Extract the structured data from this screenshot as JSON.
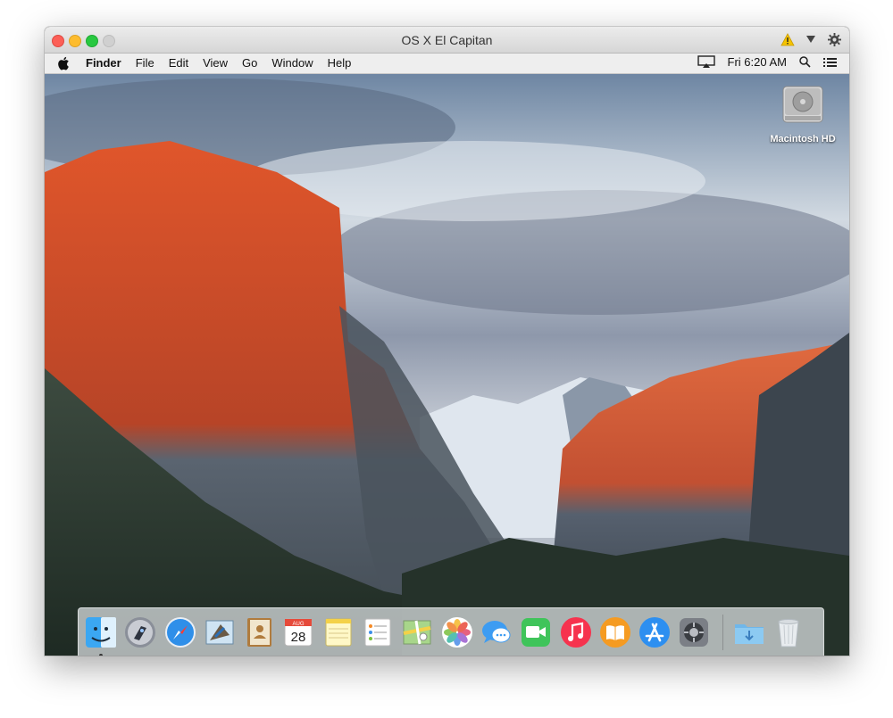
{
  "window": {
    "title": "OS X El Capitan"
  },
  "menubar": {
    "app_name": "Finder",
    "menus": [
      "File",
      "Edit",
      "View",
      "Go",
      "Window",
      "Help"
    ],
    "clock": "Fri 6:20 AM"
  },
  "desktop": {
    "icons": [
      {
        "label": "Macintosh HD",
        "icon": "hard-drive-icon"
      }
    ]
  },
  "dock": {
    "apps": [
      {
        "name": "finder",
        "icon": "finder-icon",
        "running": true
      },
      {
        "name": "launchpad",
        "icon": "launchpad-icon"
      },
      {
        "name": "safari",
        "icon": "safari-icon"
      },
      {
        "name": "mail",
        "icon": "mail-icon"
      },
      {
        "name": "contacts",
        "icon": "contacts-icon"
      },
      {
        "name": "calendar",
        "icon": "calendar-icon",
        "month": "AUG",
        "day": "28"
      },
      {
        "name": "notes",
        "icon": "notes-icon"
      },
      {
        "name": "reminders",
        "icon": "reminders-icon"
      },
      {
        "name": "maps",
        "icon": "maps-icon"
      },
      {
        "name": "photos",
        "icon": "photos-icon"
      },
      {
        "name": "messages",
        "icon": "messages-icon"
      },
      {
        "name": "facetime",
        "icon": "facetime-icon"
      },
      {
        "name": "itunes",
        "icon": "itunes-icon"
      },
      {
        "name": "ibooks",
        "icon": "ibooks-icon"
      },
      {
        "name": "app-store",
        "icon": "app-store-icon"
      },
      {
        "name": "system-preferences",
        "icon": "gear-icon"
      }
    ],
    "trailing": [
      {
        "name": "downloads",
        "icon": "downloads-folder-icon"
      },
      {
        "name": "trash",
        "icon": "trash-icon"
      }
    ]
  },
  "colors": {
    "close": "#fc5f57",
    "minimize": "#fdbc2e",
    "zoom": "#28c840",
    "warning": "#f5c400"
  }
}
